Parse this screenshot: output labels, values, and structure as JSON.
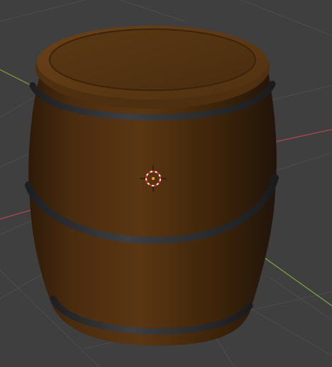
{
  "viewport": {
    "background": "#3f3f3f",
    "grid_color": "#4c4c4c",
    "x_axis_color": "#b0464e",
    "y_axis_color": "#7fa63a",
    "object": "barrel",
    "object_colors": {
      "wood_light": "#5e3a14",
      "wood_mid": "#4a2c0f",
      "wood_dark": "#2a1807",
      "hoop": "#2e2f31",
      "hoop_highlight": "#4a4c4f"
    },
    "cursor": "3d-cursor",
    "origin_marker": "object-origin-dot"
  }
}
